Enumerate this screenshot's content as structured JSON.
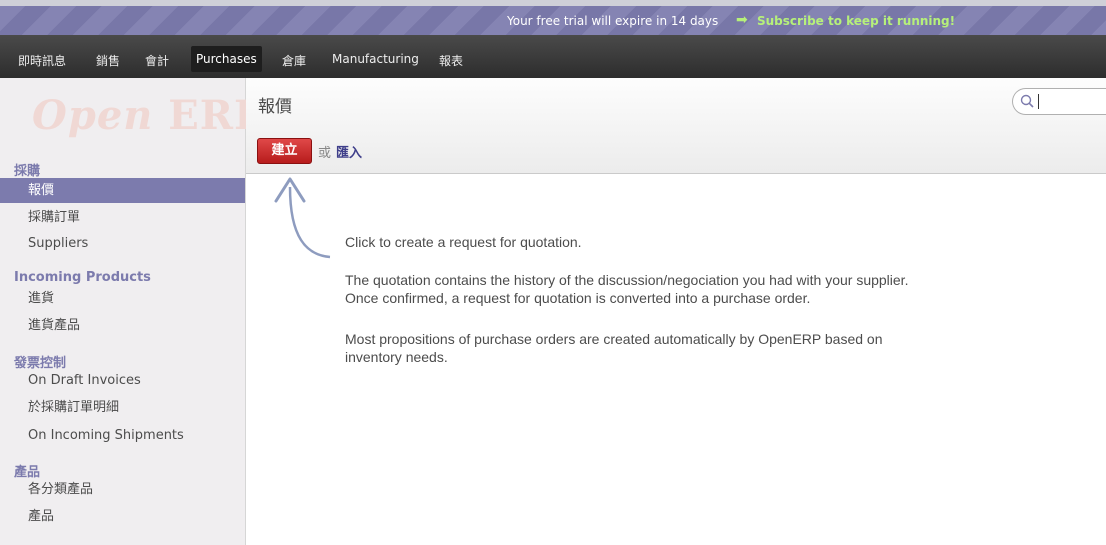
{
  "trial": {
    "message": "Your free trial will expire in 14 days",
    "arrow": "➡",
    "subscribe": "Subscribe to keep it running!"
  },
  "menu": {
    "items": [
      "即時訊息",
      "銷售",
      "會計",
      "Purchases",
      "倉庫",
      "Manufacturing",
      "報表"
    ],
    "active": "Purchases"
  },
  "logo": {
    "text1": "Open",
    "text2": "ERP"
  },
  "sidebar": {
    "sections": [
      {
        "title": "採購",
        "items": [
          "報價",
          "採購訂單",
          "Suppliers"
        ]
      },
      {
        "title": "Incoming Products",
        "items": [
          "進貨",
          "進貨產品"
        ]
      },
      {
        "title": "發票控制",
        "items": [
          "On Draft Invoices",
          "於採購訂單明細",
          "On Incoming Shipments"
        ]
      },
      {
        "title": "產品",
        "items": [
          "各分類產品",
          "產品"
        ]
      }
    ],
    "active_item": "報價"
  },
  "header": {
    "title": "報價",
    "create_label": "建立",
    "or_label": "或",
    "import_label": "匯入"
  },
  "help": {
    "line1": "Click to create a request for quotation.",
    "para2a": "The quotation contains the history of the discussion/negociation you had with your supplier.",
    "para2b": "Once confirmed, a request for quotation is converted into a purchase order.",
    "para3a": "Most propositions of purchase orders are created automatically by OpenERP based on",
    "para3b": "inventory needs."
  },
  "colors": {
    "brand": "#7c7bad",
    "create_button": "#c62828",
    "trial_link": "#b6f07a"
  }
}
